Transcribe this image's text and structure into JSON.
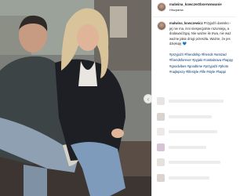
{
  "post": {
    "username": "malwina_kowczo",
    "follow_label": "• Obserwowanie",
    "location": "Hiszpania"
  },
  "caption": {
    "username": "malwina_kowczewicz",
    "lines": [
      "Przyjaźń damsko -",
      "jej nie ma, inni niespecjalnie rozumieją, a",
      "dodawać/zgaj. Nie ważne ile trwa, nie waż",
      "ważne jakie drogi przeszła. Ważne, że jes",
      "dziękuję 💙"
    ]
  },
  "hashtags": [
    "#przyjaźń #friendship #friends #amizad",
    "#friendsforever #pyjaki #costabrava #happy",
    "#goodvibes #goodtime #przyjaźń #photo",
    "#najlepszy #lifestyle #life #style #happi"
  ],
  "icons": {
    "nav_left": "chevron-left-icon"
  },
  "colors": {
    "hashtag": "#00376b",
    "text": "#262626",
    "divider": "#efefef"
  }
}
